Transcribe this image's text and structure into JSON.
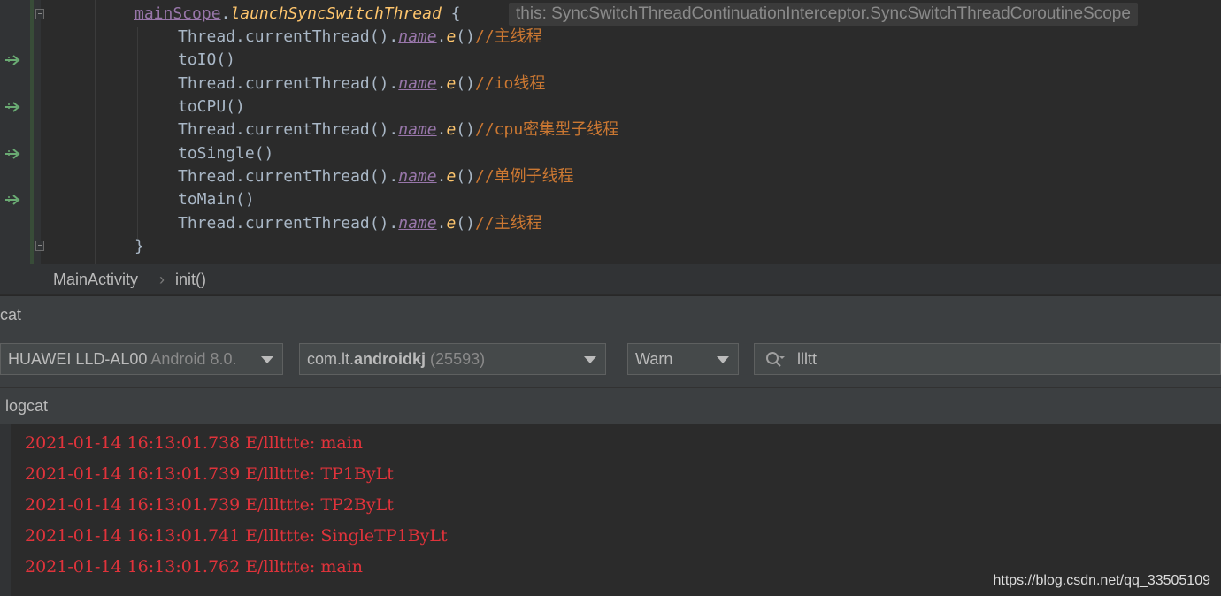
{
  "editor": {
    "lines": [
      {
        "indent": 0,
        "tokens": [
          {
            "t": "scope",
            "v": "mainScope"
          },
          {
            "t": "plain",
            "v": "."
          },
          {
            "t": "fn",
            "v": "launchSyncSwitchThread"
          },
          {
            "t": "plain",
            "v": " {"
          }
        ]
      },
      {
        "indent": 1,
        "tokens": [
          {
            "t": "plain",
            "v": "Thread.currentThread()."
          },
          {
            "t": "prop",
            "v": "name"
          },
          {
            "t": "plain",
            "v": "."
          },
          {
            "t": "ext",
            "v": "e"
          },
          {
            "t": "plain",
            "v": "()"
          },
          {
            "t": "cm",
            "v": "//主线程"
          }
        ]
      },
      {
        "indent": 1,
        "tokens": [
          {
            "t": "plain",
            "v": "toIO()"
          }
        ]
      },
      {
        "indent": 1,
        "tokens": [
          {
            "t": "plain",
            "v": "Thread.currentThread()."
          },
          {
            "t": "prop",
            "v": "name"
          },
          {
            "t": "plain",
            "v": "."
          },
          {
            "t": "ext",
            "v": "e"
          },
          {
            "t": "plain",
            "v": "()"
          },
          {
            "t": "cm",
            "v": "//io线程"
          }
        ]
      },
      {
        "indent": 1,
        "tokens": [
          {
            "t": "plain",
            "v": "toCPU()"
          }
        ]
      },
      {
        "indent": 1,
        "tokens": [
          {
            "t": "plain",
            "v": "Thread.currentThread()."
          },
          {
            "t": "prop",
            "v": "name"
          },
          {
            "t": "plain",
            "v": "."
          },
          {
            "t": "ext",
            "v": "e"
          },
          {
            "t": "plain",
            "v": "()"
          },
          {
            "t": "cm",
            "v": "//cpu密集型子线程"
          }
        ]
      },
      {
        "indent": 1,
        "tokens": [
          {
            "t": "plain",
            "v": "toSingle()"
          }
        ]
      },
      {
        "indent": 1,
        "tokens": [
          {
            "t": "plain",
            "v": "Thread.currentThread()."
          },
          {
            "t": "prop",
            "v": "name"
          },
          {
            "t": "plain",
            "v": "."
          },
          {
            "t": "ext",
            "v": "e"
          },
          {
            "t": "plain",
            "v": "()"
          },
          {
            "t": "cm",
            "v": "//单例子线程"
          }
        ]
      },
      {
        "indent": 1,
        "tokens": [
          {
            "t": "plain",
            "v": "toMain()"
          }
        ]
      },
      {
        "indent": 1,
        "tokens": [
          {
            "t": "plain",
            "v": "Thread.currentThread()."
          },
          {
            "t": "prop",
            "v": "name"
          },
          {
            "t": "plain",
            "v": "."
          },
          {
            "t": "ext",
            "v": "e"
          },
          {
            "t": "plain",
            "v": "()"
          },
          {
            "t": "cm",
            "v": "//主线程"
          }
        ]
      },
      {
        "indent": 0,
        "tokens": [
          {
            "t": "plain",
            "v": "}"
          }
        ]
      }
    ],
    "hint": "this: SyncSwitchThreadContinuationInterceptor.SyncSwitchThreadCoroutineScope",
    "suspend_call_icon": "suspend-call-arrow-icon",
    "colors": {
      "keyword": "#cc7832",
      "function": "#ffc66d",
      "property": "#9876aa",
      "text": "#a9b7c6"
    }
  },
  "breadcrumb": {
    "class_name": "MainActivity",
    "method_name": "init()"
  },
  "logcat_panel": {
    "title": "cat",
    "device_name": "HUAWEI LLD-AL00",
    "device_os": "Android 8.0.",
    "process_prefix": "com.lt.",
    "process_name": "androidkj",
    "process_pid": "(25593)",
    "level": "Warn",
    "search": {
      "value": "llltt",
      "icon": "search-icon"
    },
    "log_tab": "logcat",
    "log_color": "#e0333b",
    "log_lines": [
      "2021-01-14 16:13:01.738 E/lllttte: main",
      "2021-01-14 16:13:01.739 E/lllttte: TP1ByLt",
      "2021-01-14 16:13:01.739 E/lllttte: TP2ByLt",
      "2021-01-14 16:13:01.741 E/lllttte: SingleTP1ByLt",
      "2021-01-14 16:13:01.762 E/lllttte: main"
    ]
  },
  "watermark": "https://blog.csdn.net/qq_33505109"
}
